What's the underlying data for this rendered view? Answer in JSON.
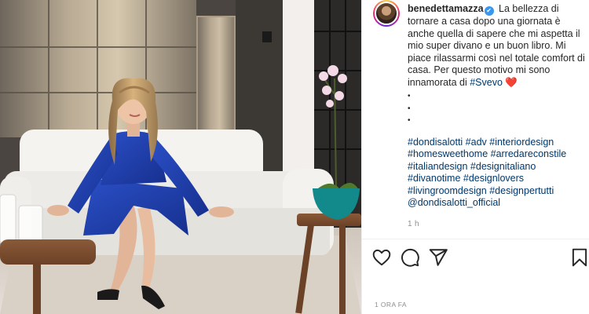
{
  "post": {
    "username": "benedettamazza",
    "verified_icon": "verified-badge-icon",
    "caption_text": "La bellezza di tornare a casa dopo una giornata è anche quella di sapere che mi aspetta il mio super divano e un buon libro. Mi piace rilassarmi così nel totale comfort di casa. Per questo motivo mi sono innamorata di ",
    "mention": "#Svevo",
    "heart_emoji": "❤️",
    "dots": [
      "•",
      "•",
      "•"
    ],
    "hashtag_lines": [
      "#dondisalotti #adv #interiordesign",
      "#homesweethome #arredareconstile",
      "#italiandesign #designitaliano",
      "#divanotime #designlovers",
      "#livingroomdesign #designpertutti",
      "@dondisalotti_official"
    ],
    "relative_time": "1 h",
    "posted_ago": "1 ORA FA"
  },
  "actions": {
    "like_icon": "heart-outline-icon",
    "comment_icon": "comment-icon",
    "share_icon": "paper-plane-icon",
    "save_icon": "bookmark-icon"
  },
  "colors": {
    "text": "#262626",
    "link": "#00376b",
    "muted": "#8e8e8e",
    "verified": "#3897f0",
    "heart": "#ed4956",
    "sofa": "#f2f1ee",
    "dress": "#1f3ea8"
  }
}
